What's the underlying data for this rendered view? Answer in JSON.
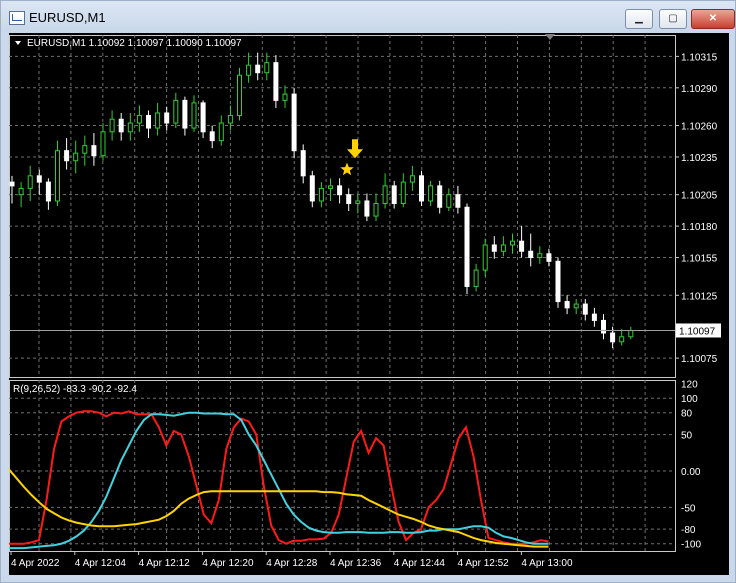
{
  "window": {
    "title": "EURUSD,M1",
    "buttons": [
      "minimize",
      "maximize",
      "close"
    ]
  },
  "chart_data": [
    {
      "type": "candlestick",
      "header": "EURUSD,M1  1.10092 1.10097 1.10090 1.10097",
      "price_ticks": [
        "1.10315",
        "1.10290",
        "1.10260",
        "1.10235",
        "1.10205",
        "1.10180",
        "1.10155",
        "1.10125",
        "1.10097",
        "1.10075"
      ],
      "current_price": "1.10097",
      "ylim": [
        1.1006,
        1.10332
      ],
      "candles": [
        [
          1.10215,
          1.10212,
          1.10198,
          1.1022
        ],
        [
          1.10205,
          1.1021,
          1.10195,
          1.10215
        ],
        [
          1.1021,
          1.1022,
          1.102,
          1.10228
        ],
        [
          1.1022,
          1.10215,
          1.10205,
          1.10225
        ],
        [
          1.10215,
          1.102,
          1.10193,
          1.10218
        ],
        [
          1.102,
          1.1024,
          1.10196,
          1.10248
        ],
        [
          1.1024,
          1.10232,
          1.10225,
          1.1025
        ],
        [
          1.10232,
          1.10238,
          1.10222,
          1.10248
        ],
        [
          1.10238,
          1.10244,
          1.10228,
          1.10252
        ],
        [
          1.10244,
          1.10236,
          1.10228,
          1.10254
        ],
        [
          1.10236,
          1.10255,
          1.10232,
          1.10262
        ],
        [
          1.10255,
          1.10265,
          1.10248,
          1.10272
        ],
        [
          1.10265,
          1.10255,
          1.10248,
          1.1027
        ],
        [
          1.10255,
          1.10262,
          1.10248,
          1.1027
        ],
        [
          1.10262,
          1.10268,
          1.10255,
          1.10276
        ],
        [
          1.10268,
          1.10258,
          1.1025,
          1.10272
        ],
        [
          1.10258,
          1.1027,
          1.10252,
          1.10278
        ],
        [
          1.1027,
          1.10262,
          1.10256,
          1.10275
        ],
        [
          1.10262,
          1.1028,
          1.10258,
          1.10286
        ],
        [
          1.1028,
          1.10258,
          1.10252,
          1.10283
        ],
        [
          1.10258,
          1.10278,
          1.10255,
          1.10284
        ],
        [
          1.10278,
          1.10255,
          1.1025,
          1.1028
        ],
        [
          1.10255,
          1.10248,
          1.10242,
          1.1026
        ],
        [
          1.10248,
          1.10262,
          1.10244,
          1.10268
        ],
        [
          1.10262,
          1.10268,
          1.10256,
          1.10276
        ],
        [
          1.10268,
          1.103,
          1.10264,
          1.10306
        ],
        [
          1.103,
          1.10308,
          1.10294,
          1.10318
        ],
        [
          1.10308,
          1.10302,
          1.10296,
          1.10318
        ],
        [
          1.10302,
          1.1031,
          1.10296,
          1.10318
        ],
        [
          1.1031,
          1.1028,
          1.10274,
          1.10316
        ],
        [
          1.1028,
          1.10285,
          1.10274,
          1.10292
        ],
        [
          1.10285,
          1.1024,
          1.10234,
          1.1029
        ],
        [
          1.1024,
          1.1022,
          1.10214,
          1.10245
        ],
        [
          1.1022,
          1.102,
          1.10195,
          1.10224
        ],
        [
          1.102,
          1.1021,
          1.10195,
          1.10215
        ],
        [
          1.1021,
          1.10212,
          1.102,
          1.10218
        ],
        [
          1.10212,
          1.10205,
          1.10198,
          1.10218
        ],
        [
          1.10205,
          1.10198,
          1.10192,
          1.1021
        ],
        [
          1.10198,
          1.102,
          1.1019,
          1.10206
        ],
        [
          1.102,
          1.10188,
          1.10184,
          1.10206
        ],
        [
          1.10188,
          1.10198,
          1.10184,
          1.10206
        ],
        [
          1.10198,
          1.10212,
          1.10194,
          1.10222
        ],
        [
          1.10212,
          1.10198,
          1.10194,
          1.10216
        ],
        [
          1.10198,
          1.10215,
          1.10195,
          1.10222
        ],
        [
          1.10215,
          1.1022,
          1.10208,
          1.10228
        ],
        [
          1.1022,
          1.102,
          1.10196,
          1.10224
        ],
        [
          1.102,
          1.10212,
          1.10196,
          1.10216
        ],
        [
          1.10212,
          1.10195,
          1.1019,
          1.10216
        ],
        [
          1.10195,
          1.10205,
          1.10192,
          1.1021
        ],
        [
          1.10205,
          1.10195,
          1.1019,
          1.10212
        ],
        [
          1.10195,
          1.10132,
          1.10126,
          1.10198
        ],
        [
          1.10132,
          1.10145,
          1.10128,
          1.1015
        ],
        [
          1.10145,
          1.10165,
          1.1014,
          1.1017
        ],
        [
          1.10165,
          1.1016,
          1.10154,
          1.10172
        ],
        [
          1.1016,
          1.10165,
          1.10156,
          1.10172
        ],
        [
          1.10165,
          1.10168,
          1.10158,
          1.10174
        ],
        [
          1.10168,
          1.1016,
          1.10155,
          1.1018
        ],
        [
          1.1016,
          1.10155,
          1.10148,
          1.10174
        ],
        [
          1.10155,
          1.10158,
          1.1015,
          1.10164
        ],
        [
          1.10158,
          1.10152,
          1.10148,
          1.10162
        ],
        [
          1.10152,
          1.1012,
          1.10115,
          1.10155
        ],
        [
          1.1012,
          1.10115,
          1.1011,
          1.10125
        ],
        [
          1.10115,
          1.10118,
          1.1011,
          1.10122
        ],
        [
          1.10118,
          1.1011,
          1.10105,
          1.10122
        ],
        [
          1.1011,
          1.10105,
          1.101,
          1.10115
        ],
        [
          1.10105,
          1.10095,
          1.1009,
          1.1011
        ],
        [
          1.10095,
          1.10088,
          1.10083,
          1.101
        ],
        [
          1.10088,
          1.10092,
          1.10085,
          1.10098
        ],
        [
          1.10092,
          1.10097,
          1.1009,
          1.101
        ]
      ],
      "arrow_color": "#ffd200",
      "grid": true,
      "colors": {
        "background": "#000000",
        "grid": "#707070",
        "bull": "#32cd32",
        "bear": "#ffffff",
        "price_line": "#a0a0a0"
      }
    },
    {
      "type": "line",
      "header": "R(9,26,52) -83.3 -90.2 -92.4",
      "ylim": [
        -110,
        125
      ],
      "yticks": [
        "120",
        "100",
        "80",
        "50",
        "0.00",
        "-50",
        "-80",
        "-100"
      ],
      "x": [
        "4 Apr 2022",
        "4 Apr 12:04",
        "4 Apr 12:12",
        "4 Apr 12:20",
        "4 Apr 12:28",
        "4 Apr 12:36",
        "4 Apr 12:44",
        "4 Apr 12:52",
        "4 Apr 13:00"
      ],
      "series": [
        {
          "color": "#ff1a1a",
          "values": [
            -100,
            -100,
            -100,
            -98,
            -95,
            -40,
            30,
            68,
            75,
            80,
            82,
            82,
            80,
            75,
            80,
            79,
            82,
            78,
            78,
            78,
            60,
            35,
            55,
            50,
            20,
            -20,
            -60,
            -72,
            -40,
            30,
            60,
            72,
            68,
            50,
            -20,
            -75,
            -95,
            -100,
            -96,
            -96,
            -94,
            -94,
            -93,
            -85,
            -60,
            -10,
            40,
            55,
            25,
            45,
            35,
            -20,
            -70,
            -95,
            -85,
            -80,
            -50,
            -40,
            -25,
            10,
            45,
            60,
            20,
            -40,
            -92,
            -95,
            -98,
            -100,
            -100,
            -100,
            -98,
            -95,
            -97
          ]
        },
        {
          "color": "#3fd3e0",
          "values": [
            -106,
            -106,
            -106,
            -105,
            -104,
            -103,
            -102,
            -100,
            -96,
            -90,
            -82,
            -70,
            -55,
            -35,
            -10,
            15,
            35,
            55,
            70,
            78,
            78,
            77,
            76,
            78,
            80,
            80,
            79,
            79,
            79,
            78,
            78,
            70,
            50,
            35,
            15,
            -5,
            -25,
            -45,
            -60,
            -70,
            -78,
            -82,
            -84,
            -85,
            -85,
            -84,
            -84,
            -84,
            -85,
            -85,
            -85,
            -84,
            -84,
            -85,
            -85,
            -84,
            -82,
            -82,
            -80,
            -80,
            -80,
            -78,
            -76,
            -76,
            -78,
            -85,
            -90,
            -92,
            -95,
            -98,
            -100,
            -100,
            -100
          ]
        },
        {
          "color": "#ffd400",
          "values": [
            2,
            -10,
            -22,
            -33,
            -43,
            -52,
            -58,
            -64,
            -68,
            -71,
            -73,
            -75,
            -76,
            -76,
            -76,
            -75,
            -74,
            -73,
            -71,
            -69,
            -67,
            -62,
            -55,
            -45,
            -38,
            -33,
            -29,
            -28,
            -28,
            -28,
            -28,
            -28,
            -28,
            -28,
            -28,
            -28,
            -28,
            -28,
            -28,
            -28,
            -28,
            -28,
            -29,
            -29,
            -30,
            -32,
            -33,
            -34,
            -40,
            -45,
            -50,
            -55,
            -60,
            -63,
            -66,
            -70,
            -75,
            -78,
            -80,
            -82,
            -84,
            -88,
            -92,
            -95,
            -97,
            -99,
            -100,
            -101,
            -102,
            -103,
            -104,
            -104,
            -104
          ]
        }
      ],
      "grid": true
    }
  ]
}
